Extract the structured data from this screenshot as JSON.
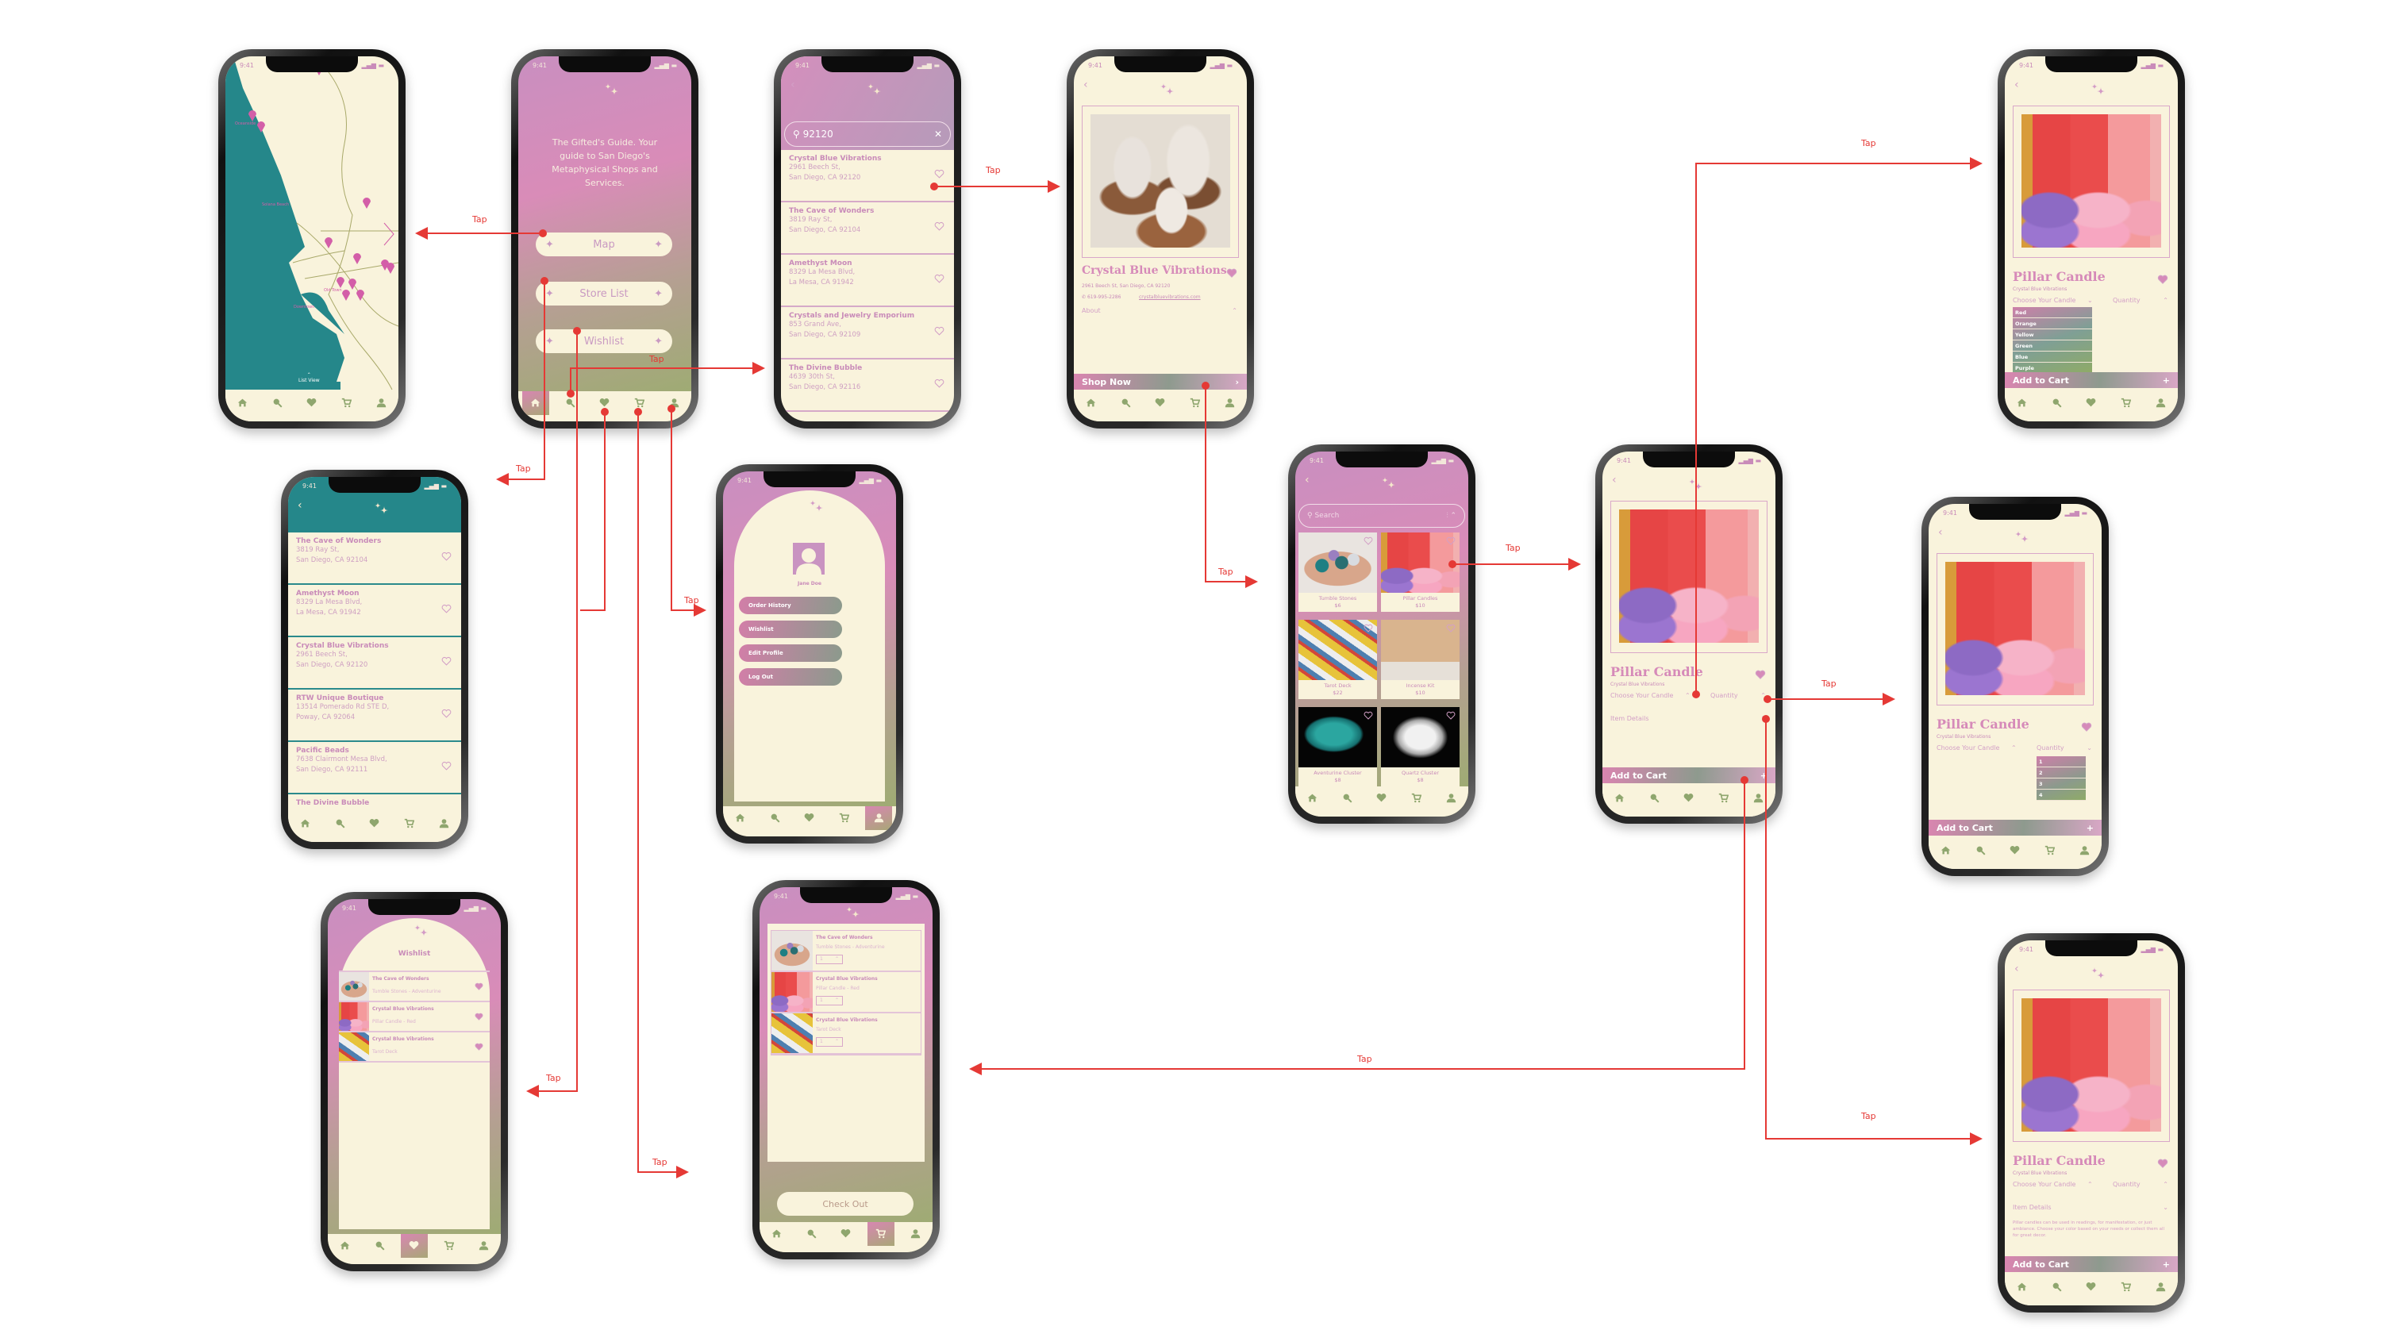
{
  "status": {
    "time": "9:41"
  },
  "connectors": {
    "tap_label": "Tap",
    "color": "#e53935"
  },
  "colors": {
    "cream": "#f9f3dc",
    "pink": "#c98bb9",
    "nav_green": "#8fa66e",
    "teal": "#25878a"
  },
  "nav": {
    "icons": [
      "home-icon",
      "search-icon",
      "heart-icon",
      "cart-icon",
      "user-icon"
    ]
  },
  "map": {
    "labels": [
      "Oceanside",
      "Solana Beach",
      "Old Town",
      "Downtown"
    ],
    "list_view": "List View"
  },
  "home": {
    "tagline": "The Gifted's Guide. Your guide to San Diego's Metaphysical Shops and Services.",
    "buttons": [
      "Map",
      "Store List",
      "Wishlist"
    ]
  },
  "search": {
    "query": "92120",
    "results": [
      {
        "name": "Crystal Blue Vibrations",
        "line1": "2961 Beech St,",
        "line2": "San Diego, CA 92120"
      },
      {
        "name": "The Cave of Wonders",
        "line1": "3819 Ray St,",
        "line2": "San Diego, CA 92104"
      },
      {
        "name": "Amethyst Moon",
        "line1": "8329 La Mesa Blvd,",
        "line2": "La Mesa, CA 91942"
      },
      {
        "name": "Crystals and Jewelry Emporium",
        "line1": "853 Grand Ave,",
        "line2": "San Diego, CA 92109"
      },
      {
        "name": "The Divine Bubble",
        "line1": "4639 30th St,",
        "line2": "San Diego, CA 92116"
      }
    ]
  },
  "store_detail": {
    "name": "Crystal Blue Vibrations",
    "address": "2961 Beech St, San Diego, CA 92120",
    "phone": "619-995-2286",
    "website": "crystalbluevibrations.com",
    "about": "About",
    "shop_now": "Shop Now"
  },
  "store_list": {
    "stores": [
      {
        "name": "The Cave of Wonders",
        "line1": "3819 Ray St,",
        "line2": "San Diego, CA 92104"
      },
      {
        "name": "Amethyst Moon",
        "line1": "8329 La Mesa Blvd,",
        "line2": "La Mesa, CA 91942"
      },
      {
        "name": "Crystal Blue Vibrations",
        "line1": "2961 Beech St,",
        "line2": "San Diego, CA 92120"
      },
      {
        "name": "RTW Unique Boutique",
        "line1": "13514 Pomerado Rd STE D,",
        "line2": "Poway, CA 92064"
      },
      {
        "name": "Pacific Beads",
        "line1": "7638 Clairmont Mesa Blvd,",
        "line2": "San Diego, CA 92111"
      },
      {
        "name": "The Divine Bubble",
        "line1": "",
        "line2": ""
      }
    ]
  },
  "profile": {
    "name": "Jane Doe",
    "menu": [
      "Order History",
      "Wishlist",
      "Edit Profile",
      "Log Out"
    ]
  },
  "products": {
    "search_placeholder": "Search",
    "items": [
      {
        "name": "Tumble Stones",
        "price": "$6",
        "image": "stones"
      },
      {
        "name": "Pillar Candles",
        "price": "$10",
        "image": "candles"
      },
      {
        "name": "Tarot Deck",
        "price": "$22",
        "image": "tarot"
      },
      {
        "name": "Incense Kit",
        "price": "$10",
        "image": "incense"
      },
      {
        "name": "Aventurine Cluster",
        "price": "$8",
        "image": "aventurine"
      },
      {
        "name": "Quartz Cluster",
        "price": "$8",
        "image": "quartz"
      }
    ]
  },
  "product": {
    "title": "Pillar Candle",
    "store": "Crystal Blue Vibrations",
    "choose_label": "Choose Your Candle",
    "quantity_label": "Quantity",
    "details_label": "Item Details",
    "details_text": "Pillar candles can be used in readings, for manifestation, or just ambiance. Choose your color based on your needs or collect them all for great decor.",
    "add_to_cart": "Add to Cart",
    "colors": [
      "Red",
      "Orange",
      "Yellow",
      "Green",
      "Blue",
      "Purple"
    ],
    "quantities": [
      "1",
      "2",
      "3",
      "4"
    ]
  },
  "wishlist": {
    "title": "Wishlist",
    "items": [
      {
        "store": "The Cave of Wonders",
        "item": "Tumble Stones - Adventurine",
        "image": "stones"
      },
      {
        "store": "Crystal Blue Vibrations",
        "item": "Pillar Candle - Red",
        "image": "candles"
      },
      {
        "store": "Crystal Blue Vibrations",
        "item": "Tarot Deck",
        "image": "tarot"
      }
    ]
  },
  "cart": {
    "items": [
      {
        "store": "The Cave of Wonders",
        "item": "Tumble Stones - Adventurine",
        "qty": "1",
        "image": "stones"
      },
      {
        "store": "Crystal Blue Vibrations",
        "item": "Pillar Candle - Red",
        "qty": "1",
        "image": "candles"
      },
      {
        "store": "Crystal Blue Vibrations",
        "item": "Tarot Deck",
        "qty": "1",
        "image": "tarot"
      }
    ],
    "checkout": "Check Out"
  }
}
